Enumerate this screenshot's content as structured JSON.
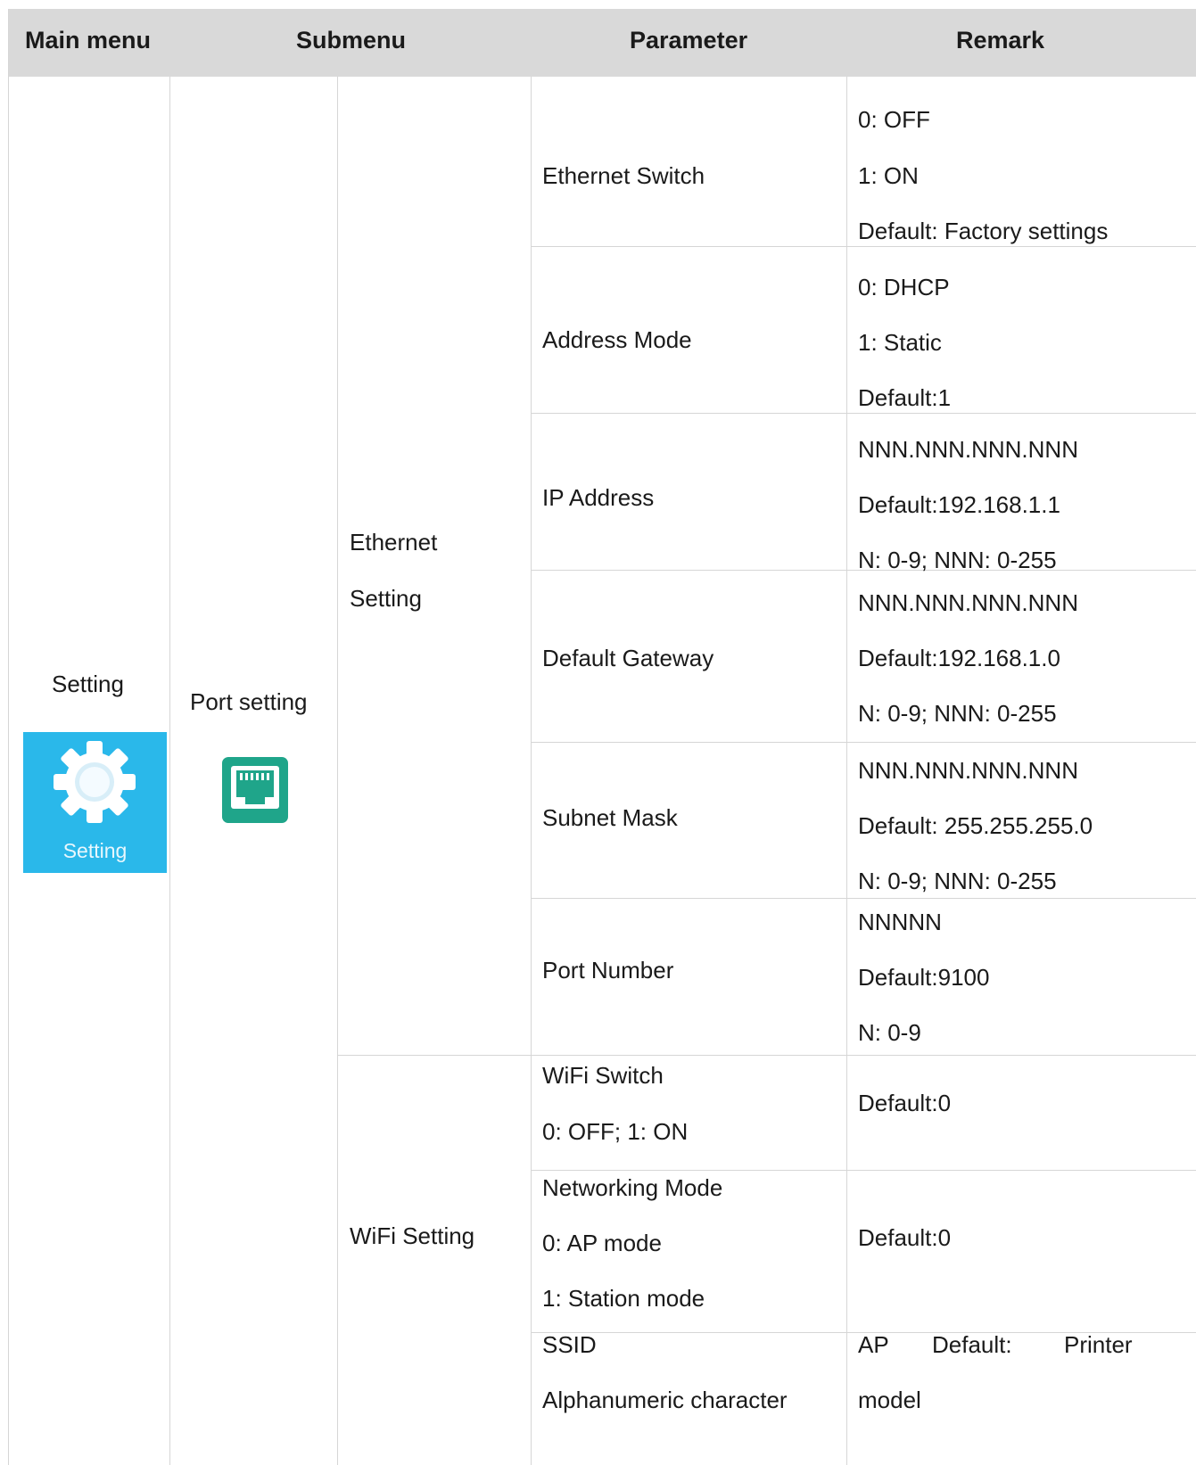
{
  "headers": {
    "main_menu": "Main menu",
    "submenu": "Submenu",
    "parameter": "Parameter",
    "remark": "Remark"
  },
  "main_menu": {
    "label": "Setting",
    "icon": "gear-icon",
    "tile_label": "Setting",
    "tile_color": "#2ab8ea"
  },
  "submenu": {
    "label": "Port setting",
    "icon": "ethernet-port-icon",
    "icon_color": "#1fa58a"
  },
  "groups": {
    "ethernet": {
      "line1": "Ethernet",
      "line2": "Setting"
    },
    "wifi": {
      "label": "WiFi Setting"
    }
  },
  "rows": {
    "ethernet_switch": {
      "parameter": "Ethernet Switch",
      "remark": [
        "0: OFF",
        "1: ON",
        "Default: Factory settings"
      ]
    },
    "address_mode": {
      "parameter": "Address Mode",
      "remark": [
        "0: DHCP",
        "1: Static",
        "Default:1"
      ]
    },
    "ip_address": {
      "parameter": "IP Address",
      "remark": [
        "NNN.NNN.NNN.NNN",
        "Default:192.168.1.1",
        "N: 0-9; NNN: 0-255"
      ]
    },
    "default_gateway": {
      "parameter": "Default Gateway",
      "remark": [
        "NNN.NNN.NNN.NNN",
        "Default:192.168.1.0",
        "N: 0-9; NNN: 0-255"
      ]
    },
    "subnet_mask": {
      "parameter": "Subnet Mask",
      "remark": [
        "NNN.NNN.NNN.NNN",
        "Default: 255.255.255.0",
        "N: 0-9; NNN: 0-255"
      ]
    },
    "port_number": {
      "parameter": "Port Number",
      "remark": [
        "NNNNN",
        "Default:9100",
        "N: 0-9"
      ]
    },
    "wifi_switch": {
      "parameter": [
        "WiFi Switch",
        "0: OFF; 1: ON"
      ],
      "remark": "Default:0"
    },
    "networking_mode": {
      "parameter": [
        "Networking Mode",
        "0: AP mode",
        "1: Station mode"
      ],
      "remark": "Default:0"
    },
    "ssid": {
      "parameter": [
        "SSID",
        "Alphanumeric character"
      ],
      "remark": [
        "AP",
        "Default:",
        "Printer",
        "model"
      ]
    }
  }
}
